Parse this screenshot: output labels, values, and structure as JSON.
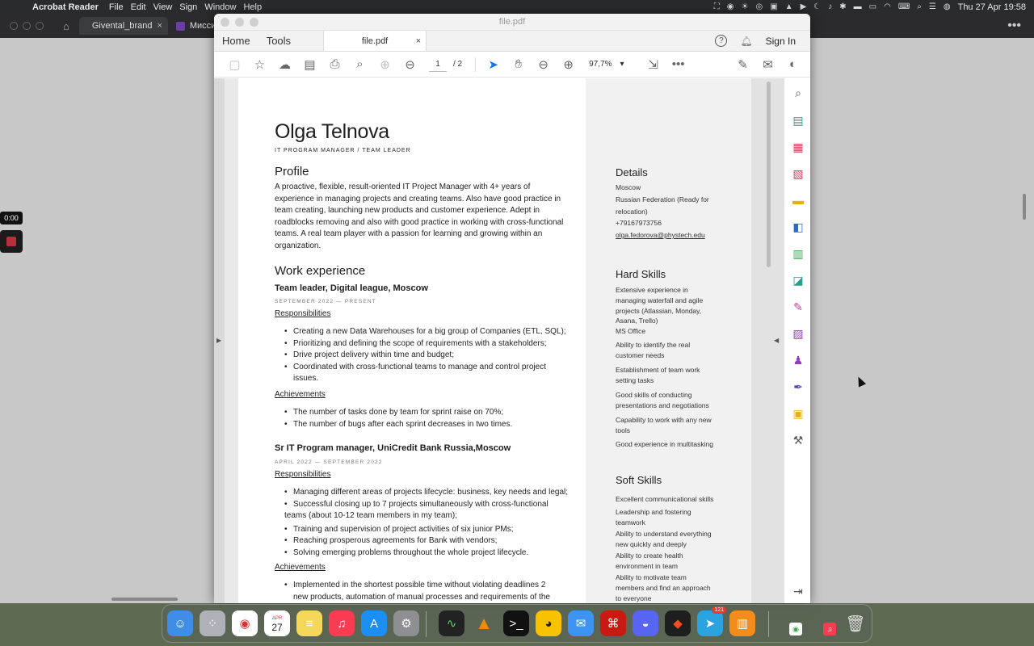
{
  "menubar": {
    "app_name": "Acrobat Reader",
    "menus": [
      "File",
      "Edit",
      "View",
      "Sign",
      "Window",
      "Help"
    ],
    "datetime": "Thu 27 Apr  19:58"
  },
  "browser": {
    "tabs": [
      {
        "label": "Givental_brand",
        "color": "#1e6fd9"
      },
      {
        "label": "Миссия вы",
        "color": "#6b3fa0"
      }
    ],
    "recorder_time": "0:00"
  },
  "acrobat": {
    "window_title": "file.pdf",
    "nav": {
      "home": "Home",
      "tools": "Tools"
    },
    "doc_tab": "file.pdf",
    "help": "?",
    "sign_in": "Sign In",
    "page_current": "1",
    "page_total": "/ 2",
    "zoom": "97,7%",
    "accent": "#1a73e8"
  },
  "resume": {
    "name": "Olga Telnova",
    "role": "IT PROGRAM MANAGER / TEAM LEADER",
    "profile_heading": "Profile",
    "profile_lines": [
      "A proactive, flexible, result-oriented IT Project Manager with 4+ years of",
      "experience in managing projects and creating teams. Also have good practice in",
      "team creating, launching new products and customer experience. Adept in",
      "roadblocks removing and also with good practice in working with cross-functional",
      "teams. A real team player with a passion for learning and growing within an",
      "organization."
    ],
    "work_heading": "Work experience",
    "job1": {
      "title": "Team leader,  Digital league, Moscow",
      "dates": "SEPTEMBER 2022 — PRESENT",
      "resp_label": "Responsibilities",
      "resp": [
        "Creating a new Data Warehouses for a big group of Companies (ETL, SQL);",
        "Prioritizing and defining the scope of requirements with a stakeholders;",
        "Drive project delivery within time and budget;",
        "Coordinated with cross-functional teams to manage and control project",
        "issues."
      ],
      "ach_label": "Achievements",
      "ach": [
        "The number of tasks done by team for sprint raise on 70%;",
        "The number of bugs after each sprint decreases in two times."
      ]
    },
    "job2": {
      "title": "Sr IT Program manager,  UniCredit Bank Russia,Moscow",
      "dates": "APRIL 2022 — SEPTEMBER 2022",
      "resp_label": "Responsibilities",
      "resp": [
        "Managing different areas of projects lifecycle: business, key needs and legal;",
        "Successful closing up to 7 projects simultaneously with cross-functional",
        "teams (about 10-12 team members in my team);",
        "Training and supervision of project activities of six junior PMs;",
        "Reaching prosperous agreements for Bank with vendors;",
        "Solving emerging problems throughout the whole project lifecycle."
      ],
      "ach_label": "Achievements",
      "ach": [
        "Implemented in the shortest possible time without violating deadlines 2",
        "new products, automation of manual processes and requirements of the"
      ]
    },
    "details": {
      "heading": "Details",
      "city": "Moscow",
      "country1": "Russian Federation  (Ready for",
      "country2": "relocation)",
      "phone": "+79167973756",
      "email": "olga.fedorova@phystech.edu"
    },
    "hard_skills": {
      "heading": "Hard Skills",
      "items": [
        [
          "Extensive experience in",
          "managing waterfall and agile",
          "projects (Atlassian, Monday,",
          "Asana, Trello)",
          "MS Office"
        ],
        [
          "Ability to identify the real",
          "customer needs"
        ],
        [
          "Establishment of team work",
          "setting tasks"
        ],
        [
          "Good skills of conducting",
          "presentations and negotiations"
        ],
        [
          "Capability to work with any new",
          "tools"
        ],
        [
          "Good experience in multitasking"
        ]
      ]
    },
    "soft_skills": {
      "heading": "Soft Skills",
      "items": [
        [
          "Excellent communicational skills"
        ],
        [
          "Leadership and fostering",
          "teamwork"
        ],
        [
          "Ability to understand everything",
          "new quickly and deeply"
        ],
        [
          "Ability to create health",
          "environment in team"
        ],
        [
          "Ability to motivate team",
          "members and find an approach",
          "to everyone"
        ]
      ]
    }
  },
  "dock": {
    "calendar_month": "APR",
    "calendar_day": "27",
    "telegram_badge": "121"
  }
}
